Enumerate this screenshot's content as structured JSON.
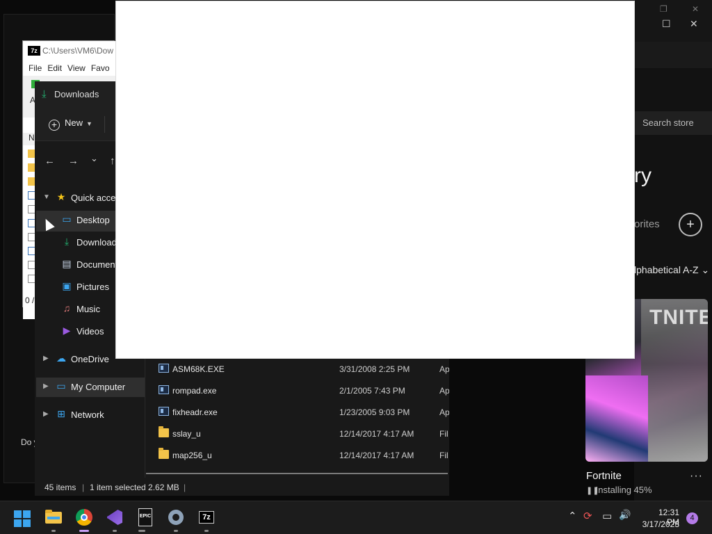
{
  "background_window": {
    "hint_text": "Do y"
  },
  "epic": {
    "search_placeholder": "Search store",
    "heading_visible": "ry",
    "favorites_visible": "orites",
    "add_label": "+",
    "sort_visible": "lphabetical A-Z",
    "sort_chevron": "⌄",
    "window_controls": {
      "restore": "❐",
      "maximize": "☐",
      "close": "✕"
    },
    "dark_frame_controls": {
      "restore": "❐",
      "close": "✕"
    },
    "game": {
      "title": "Fortnite",
      "logo_text": "TNITE",
      "more_label": "···",
      "status_icon": "pause-icon",
      "status": "Installing 45%",
      "progress_percent": 45
    }
  },
  "sevenzip": {
    "logo": "7z",
    "title_path": "C:\\Users\\VM6\\Dow",
    "menu": [
      "File",
      "Edit",
      "View",
      "Favo"
    ],
    "column_header_visible": "N",
    "address_visible": "A",
    "status_visible": "0 /"
  },
  "explorer": {
    "title": "Downloads",
    "new_label": "New",
    "nav": {
      "back": "←",
      "forward": "→",
      "recent": "⌄",
      "up": "↑"
    },
    "sidebar": [
      {
        "label": "Quick access",
        "icon": "star-icon",
        "expanded": true
      },
      {
        "label": "Desktop",
        "icon": "desktop-icon",
        "selected": true
      },
      {
        "label": "Downloads",
        "icon": "download-icon"
      },
      {
        "label": "Documents",
        "icon": "document-icon"
      },
      {
        "label": "Pictures",
        "icon": "pictures-icon"
      },
      {
        "label": "Music",
        "icon": "music-icon"
      },
      {
        "label": "Videos",
        "icon": "videos-icon"
      },
      {
        "label": "OneDrive",
        "icon": "cloud-icon"
      },
      {
        "label": "My Computer",
        "icon": "computer-icon",
        "selected": true
      },
      {
        "label": "Network",
        "icon": "network-icon"
      }
    ],
    "files": [
      {
        "name": "ASM68K.EXE",
        "date": "3/31/2008 2:25 PM",
        "type": "Ap",
        "icon": "exe-icon"
      },
      {
        "name": "rompad.exe",
        "date": "2/1/2005 7:43 PM",
        "type": "Ap",
        "icon": "exe-icon"
      },
      {
        "name": "fixheadr.exe",
        "date": "1/23/2005 9:03 PM",
        "type": "Ap",
        "icon": "exe-icon"
      },
      {
        "name": "sslay_u",
        "date": "12/14/2017 4:17 AM",
        "type": "Fil",
        "icon": "folder-icon"
      },
      {
        "name": "map256_u",
        "date": "12/14/2017 4:17 AM",
        "type": "Fil",
        "icon": "folder-icon"
      }
    ],
    "status": {
      "count": "45 items",
      "selection": "1 item selected  2.62 MB",
      "sep": "|"
    }
  },
  "taskbar": {
    "apps": [
      "start-icon",
      "file-explorer-icon",
      "chrome-icon",
      "visual-studio-icon",
      "epic-games-icon",
      "settings-icon",
      "7zip-icon"
    ],
    "epic_logo": "EPIC",
    "sevenzip_logo": "7z",
    "tray": {
      "overflow": "⌃",
      "volume": "🔊"
    },
    "time": "12:31 PM",
    "date": "3/17/2023",
    "notifications": "4"
  }
}
